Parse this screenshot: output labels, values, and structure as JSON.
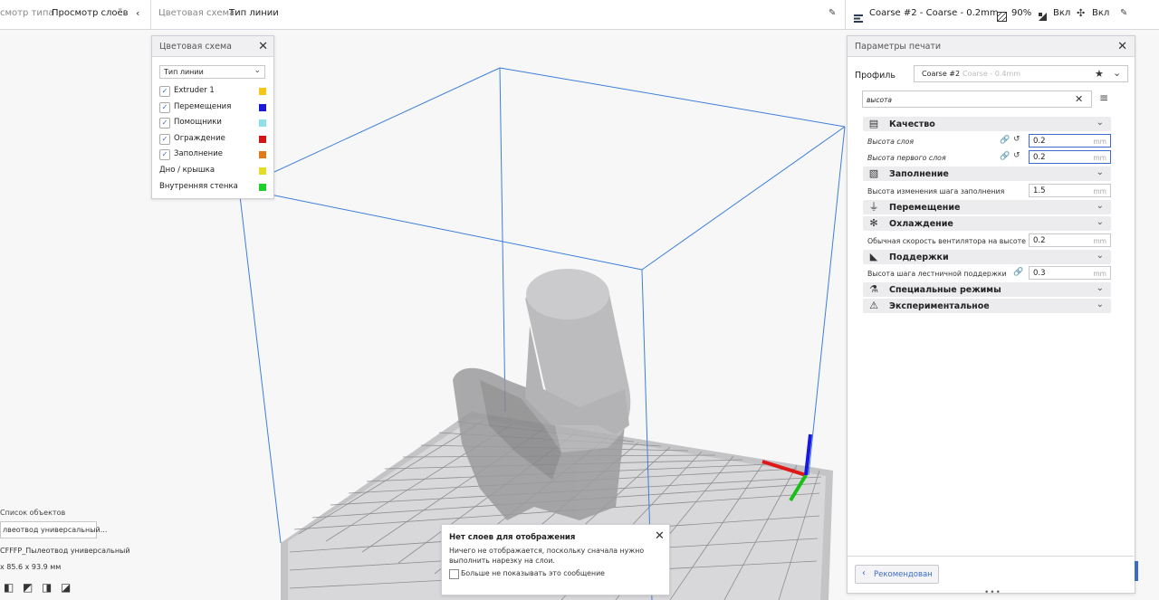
{
  "topbar": {
    "view_type_label": "смотр типа",
    "view_mode": "Просмотр слоёв",
    "color_scheme_label": "Цветовая схема",
    "color_scheme_value": "Тип линии",
    "profile": "Coarse #2 - Coarse - 0.2mm",
    "infill": "90%",
    "support": "Вкл",
    "adhesion": "Вкл"
  },
  "color_scheme_panel": {
    "title": "Цветовая схема",
    "dropdown_value": "Тип линии",
    "items": [
      {
        "label": "Extruder 1",
        "checked": true,
        "color": "#f5c518"
      },
      {
        "label": "Перемещения",
        "checked": true,
        "color": "#1a1ad6"
      },
      {
        "label": "Помощники",
        "checked": true,
        "color": "#8fe0e8"
      },
      {
        "label": "Ограждение",
        "checked": true,
        "color": "#d01818"
      },
      {
        "label": "Заполнение",
        "checked": true,
        "color": "#e07b1a"
      },
      {
        "label": "Дно / крышка",
        "checked": false,
        "color": "#e6dc28"
      },
      {
        "label": "Внутренняя стенка",
        "checked": false,
        "color": "#1fcf2a"
      }
    ]
  },
  "print_settings": {
    "title": "Параметры печати",
    "profile_label": "Профиль",
    "profile_value": "Coarse #2",
    "profile_hint": "Coarse - 0.4mm",
    "search_value": "высота",
    "categories": [
      {
        "label": "Качество",
        "icon": "quality-icon"
      },
      {
        "label": "Заполнение",
        "icon": "infill-icon"
      },
      {
        "label": "Перемещение",
        "icon": "travel-icon"
      },
      {
        "label": "Охлаждение",
        "icon": "cooling-icon"
      },
      {
        "label": "Поддержки",
        "icon": "support-icon"
      },
      {
        "label": "Специальные режимы",
        "icon": "special-modes-icon"
      },
      {
        "label": "Экспериментальное",
        "icon": "experimental-icon"
      }
    ],
    "settings": {
      "layer_height": {
        "label": "Высота слоя",
        "value": "0.2",
        "unit": "mm"
      },
      "initial_layer_height": {
        "label": "Высота первого слоя",
        "value": "0.2",
        "unit": "mm"
      },
      "gradual_infill_step": {
        "label": "Высота изменения шага заполнения",
        "value": "1.5",
        "unit": "mm"
      },
      "fan_speed_height": {
        "label": "Обычная скорость вентилятора на высоте",
        "value": "0.2",
        "unit": "mm"
      },
      "support_stair_height": {
        "label": "Высота шага лестничной поддержки",
        "value": "0.3",
        "unit": "mm"
      }
    },
    "recommended_button": "Рекомендован"
  },
  "object_list": {
    "title": "Список объектов",
    "item": "лвеотвод универсальный...",
    "filename": "CFFFP_Пылеотвод универсальный",
    "dimensions": "x 85.6 x 93.9 мм"
  },
  "message": {
    "title": "Нет слоев для отображения",
    "body": "Ничего не отображается, поскольку сначала нужно выполнить нарезку на слои.",
    "checkbox_label": "Больше не показывать это сообщение"
  },
  "colors": {
    "accent": "#3b6bc7",
    "axis_x": "#e01818",
    "axis_y": "#18c018",
    "axis_z": "#1818e0",
    "build_volume": "#3d7fd8"
  }
}
